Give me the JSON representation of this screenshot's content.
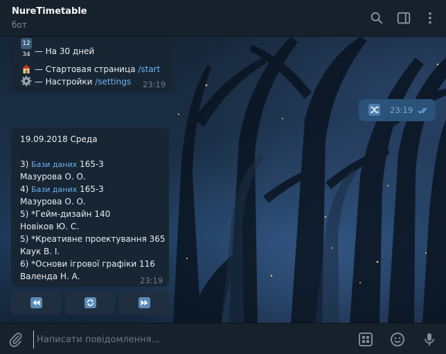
{
  "header": {
    "title": "NureTimetable",
    "subtitle": "бот",
    "icons": [
      "search-icon",
      "sidebar-toggle-icon",
      "more-vertical-icon"
    ]
  },
  "msg1": {
    "line_30days_emoji": "12 34",
    "line_30days": " — На 30 дней",
    "line_start": " — Стартовая страница ",
    "cmd_start": "/start",
    "line_settings": " — Настройки ",
    "cmd_settings": "/settings",
    "time": "23:19"
  },
  "out_msg": {
    "icon": "shuffle-icon",
    "time": "23:19",
    "status": "read"
  },
  "msg2": {
    "date": "19.09.2018 Среда",
    "lessons": [
      {
        "num": "3) ",
        "subject": "Бази даних",
        "room": " 165-3",
        "teacher": "Мазурова О. О."
      },
      {
        "num": "4) ",
        "subject": "Бази даних",
        "room": " 165-3",
        "teacher": "Мазурова О. О."
      },
      {
        "num": "5) ",
        "subject": "*Гейм-дизайн",
        "room": " 140",
        "teacher": "Новіков Ю. С."
      },
      {
        "num": "5) ",
        "subject": "*Креативне проектування",
        "room": " 365",
        "teacher": "Каук В. І."
      },
      {
        "num": "6) ",
        "subject": "*Основи ігрової графіки",
        "room": " 116",
        "teacher": "Валенда Н. А."
      }
    ],
    "time": "23:19"
  },
  "keyboard": {
    "buttons": [
      {
        "icon": "rewind-icon"
      },
      {
        "icon": "refresh-icon"
      },
      {
        "icon": "fast-forward-icon"
      }
    ]
  },
  "composer": {
    "placeholder": "Написати повідомлення...",
    "value": ""
  },
  "colors": {
    "header_bg": "#17212b",
    "bubble_in": "#182533",
    "bubble_out": "#2b5278",
    "link": "#6ab3f3"
  }
}
